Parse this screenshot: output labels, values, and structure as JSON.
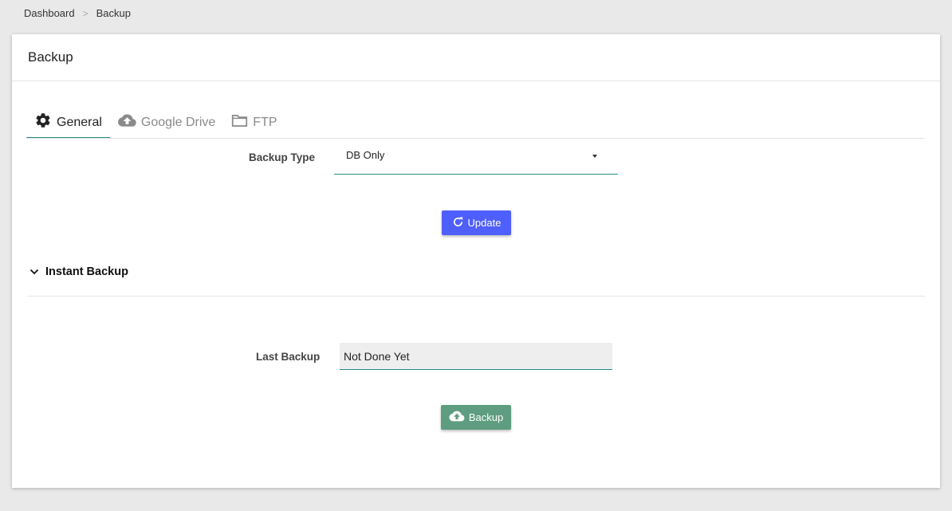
{
  "breadcrumb": {
    "items": [
      "Dashboard",
      "Backup"
    ],
    "separator": ">"
  },
  "card": {
    "title": "Backup"
  },
  "tabs": [
    {
      "label": "General",
      "icon": "gear-icon",
      "active": true
    },
    {
      "label": "Google Drive",
      "icon": "cloud-upload-icon",
      "active": false
    },
    {
      "label": "FTP",
      "icon": "folder-icon",
      "active": false
    }
  ],
  "general": {
    "backup_type_label": "Backup Type",
    "backup_type_value": "DB Only",
    "update_button": "Update"
  },
  "instant_backup": {
    "title": "Instant Backup",
    "last_backup_label": "Last Backup",
    "last_backup_value": "Not Done Yet",
    "backup_button": "Backup"
  },
  "colors": {
    "update_button": "#4f5ffb",
    "backup_button": "#5e9d7f",
    "accent_underline": "#2a8a8f",
    "background": "#e9e9e9"
  }
}
